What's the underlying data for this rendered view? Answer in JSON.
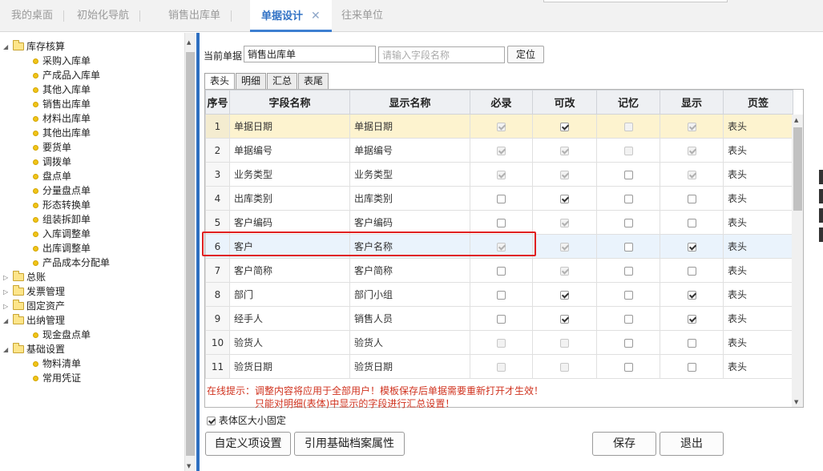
{
  "tabs": [
    {
      "label": "我的桌面",
      "active": false
    },
    {
      "label": "初始化导航",
      "active": false
    },
    {
      "label": "销售出库单",
      "active": false
    },
    {
      "label": "单据设计",
      "active": true
    },
    {
      "label": "往来单位",
      "active": false
    }
  ],
  "tab_close_glyph": "✕",
  "tree": [
    {
      "label": "库存核算",
      "type": "folder",
      "expanded": true
    },
    {
      "label": "采购入库单",
      "type": "leaf"
    },
    {
      "label": "产成品入库单",
      "type": "leaf"
    },
    {
      "label": "其他入库单",
      "type": "leaf"
    },
    {
      "label": "销售出库单",
      "type": "leaf"
    },
    {
      "label": "材料出库单",
      "type": "leaf"
    },
    {
      "label": "其他出库单",
      "type": "leaf"
    },
    {
      "label": "要货单",
      "type": "leaf"
    },
    {
      "label": "调拨单",
      "type": "leaf"
    },
    {
      "label": "盘点单",
      "type": "leaf"
    },
    {
      "label": "分量盘点单",
      "type": "leaf"
    },
    {
      "label": "形态转换单",
      "type": "leaf"
    },
    {
      "label": "组装拆卸单",
      "type": "leaf"
    },
    {
      "label": "入库调整单",
      "type": "leaf"
    },
    {
      "label": "出库调整单",
      "type": "leaf"
    },
    {
      "label": "产品成本分配单",
      "type": "leaf"
    },
    {
      "label": "总账",
      "type": "folder",
      "expanded": false
    },
    {
      "label": "发票管理",
      "type": "folder",
      "expanded": false
    },
    {
      "label": "固定资产",
      "type": "folder",
      "expanded": false
    },
    {
      "label": "出纳管理",
      "type": "folder",
      "expanded": true
    },
    {
      "label": "现金盘点单",
      "type": "leaf"
    },
    {
      "label": "基础设置",
      "type": "folder",
      "expanded": true
    },
    {
      "label": "物料清单",
      "type": "leaf"
    },
    {
      "label": "常用凭证",
      "type": "leaf"
    }
  ],
  "form": {
    "current_doc_label": "当前单据",
    "current_doc_value": "销售出库单",
    "field_search_placeholder": "请输入字段名称",
    "locate_button": "定位"
  },
  "subtabs": [
    "表头",
    "明细",
    "汇总",
    "表尾"
  ],
  "grid": {
    "headers": [
      "序号",
      "字段名称",
      "显示名称",
      "必录",
      "可改",
      "记忆",
      "显示",
      "页签"
    ],
    "rows": [
      {
        "no": "1",
        "field": "单据日期",
        "display": "单据日期",
        "required": {
          "on": true,
          "enabled": false
        },
        "editable": {
          "on": true,
          "enabled": true
        },
        "memory": {
          "on": false,
          "enabled": false
        },
        "show": {
          "on": true,
          "enabled": false
        },
        "tab": "表头"
      },
      {
        "no": "2",
        "field": "单据编号",
        "display": "单据编号",
        "required": {
          "on": true,
          "enabled": false
        },
        "editable": {
          "on": true,
          "enabled": false
        },
        "memory": {
          "on": false,
          "enabled": false
        },
        "show": {
          "on": true,
          "enabled": false
        },
        "tab": "表头"
      },
      {
        "no": "3",
        "field": "业务类型",
        "display": "业务类型",
        "required": {
          "on": true,
          "enabled": false
        },
        "editable": {
          "on": true,
          "enabled": false
        },
        "memory": {
          "on": false,
          "enabled": true
        },
        "show": {
          "on": true,
          "enabled": false
        },
        "tab": "表头"
      },
      {
        "no": "4",
        "field": "出库类别",
        "display": "出库类别",
        "required": {
          "on": false,
          "enabled": true
        },
        "editable": {
          "on": true,
          "enabled": true
        },
        "memory": {
          "on": false,
          "enabled": true
        },
        "show": {
          "on": false,
          "enabled": true
        },
        "tab": "表头"
      },
      {
        "no": "5",
        "field": "客户编码",
        "display": "客户编码",
        "required": {
          "on": false,
          "enabled": true
        },
        "editable": {
          "on": true,
          "enabled": false
        },
        "memory": {
          "on": false,
          "enabled": true
        },
        "show": {
          "on": false,
          "enabled": true
        },
        "tab": "表头"
      },
      {
        "no": "6",
        "field": "客户",
        "display": "客户名称",
        "required": {
          "on": true,
          "enabled": false
        },
        "editable": {
          "on": true,
          "enabled": false
        },
        "memory": {
          "on": false,
          "enabled": true
        },
        "show": {
          "on": true,
          "enabled": true
        },
        "tab": "表头"
      },
      {
        "no": "7",
        "field": "客户简称",
        "display": "客户简称",
        "required": {
          "on": false,
          "enabled": true
        },
        "editable": {
          "on": true,
          "enabled": false
        },
        "memory": {
          "on": false,
          "enabled": true
        },
        "show": {
          "on": false,
          "enabled": true
        },
        "tab": "表头"
      },
      {
        "no": "8",
        "field": "部门",
        "display": "部门小组",
        "required": {
          "on": false,
          "enabled": true
        },
        "editable": {
          "on": true,
          "enabled": true
        },
        "memory": {
          "on": false,
          "enabled": true
        },
        "show": {
          "on": true,
          "enabled": true
        },
        "tab": "表头"
      },
      {
        "no": "9",
        "field": "经手人",
        "display": "销售人员",
        "required": {
          "on": false,
          "enabled": true
        },
        "editable": {
          "on": true,
          "enabled": true
        },
        "memory": {
          "on": false,
          "enabled": true
        },
        "show": {
          "on": true,
          "enabled": true
        },
        "tab": "表头"
      },
      {
        "no": "10",
        "field": "验货人",
        "display": "验货人",
        "required": {
          "on": false,
          "enabled": false
        },
        "editable": {
          "on": false,
          "enabled": false
        },
        "memory": {
          "on": false,
          "enabled": true
        },
        "show": {
          "on": false,
          "enabled": true
        },
        "tab": "表头"
      },
      {
        "no": "11",
        "field": "验货日期",
        "display": "验货日期",
        "required": {
          "on": false,
          "enabled": false
        },
        "editable": {
          "on": false,
          "enabled": false
        },
        "memory": {
          "on": false,
          "enabled": true
        },
        "show": {
          "on": false,
          "enabled": true
        },
        "tab": "表头"
      }
    ]
  },
  "hints": {
    "line1": "在线提示：调整内容将应用于全部用户！模板保存后单据需要重新打开才生效！",
    "line2": "只能对明细(表体)中显示的字段进行汇总设置！"
  },
  "fixed_size": {
    "label": "表体区大小固定",
    "checked": true
  },
  "buttons": {
    "custom_items": "自定义项设置",
    "ref_attributes": "引用基础档案属性",
    "save": "保存",
    "exit": "退出"
  },
  "scroll_glyphs": {
    "up": "▲",
    "down": "▼"
  },
  "colors": {
    "accent": "#3172c5",
    "hint": "#d0331f",
    "highlight_box": "#e02020",
    "selected_row": "#fdf3cf"
  }
}
